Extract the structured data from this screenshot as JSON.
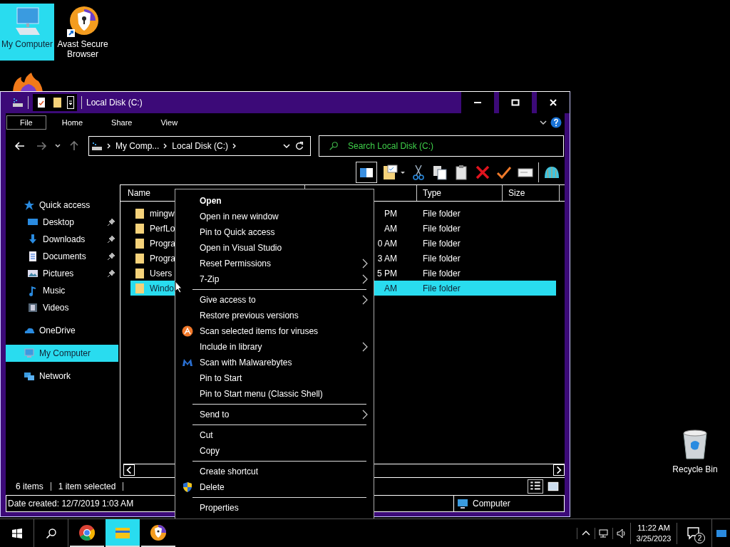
{
  "desktop_icons": [
    {
      "kind": "computer",
      "label": "My Computer",
      "selected": true
    },
    {
      "kind": "avast",
      "label": "Avast Secure Browser",
      "selected": false
    }
  ],
  "recycle_bin": {
    "label": "Recycle Bin"
  },
  "window": {
    "title": "Local Disk (C:)"
  },
  "ribbon_tabs": [
    {
      "label": "File",
      "selected": true
    },
    {
      "label": "Home",
      "selected": false
    },
    {
      "label": "Share",
      "selected": false
    },
    {
      "label": "View",
      "selected": false
    }
  ],
  "address": {
    "crumbs": [
      "My Comp...",
      "Local Disk (C:)"
    ]
  },
  "search": {
    "placeholder": "Search Local Disk (C:)"
  },
  "sidebar": {
    "items": [
      {
        "kind": "star",
        "label": "Quick access",
        "selected": false,
        "children": [
          {
            "kind": "desktop",
            "label": "Desktop",
            "pinned": true,
            "selected": false
          },
          {
            "kind": "downloads",
            "label": "Downloads",
            "pinned": true,
            "selected": false
          },
          {
            "kind": "documents",
            "label": "Documents",
            "pinned": true,
            "selected": false
          },
          {
            "kind": "pictures",
            "label": "Pictures",
            "pinned": true,
            "selected": false
          },
          {
            "kind": "music",
            "label": "Music",
            "pinned": false,
            "selected": false
          },
          {
            "kind": "videos",
            "label": "Videos",
            "pinned": false,
            "selected": false
          }
        ]
      },
      {
        "kind": "cloud",
        "label": "OneDrive",
        "selected": false
      },
      {
        "kind": "computer",
        "label": "My Computer",
        "selected": true
      },
      {
        "kind": "network",
        "label": "Network",
        "selected": false
      }
    ]
  },
  "table": {
    "columns": [
      "Name",
      "Type",
      "Size"
    ],
    "rows": [
      {
        "name": "mingw",
        "column_2": "PM",
        "type": "File folder",
        "selected": false
      },
      {
        "name": "PerfLo",
        "column_2": "AM",
        "type": "File folder",
        "selected": false
      },
      {
        "name": "Progra",
        "column_2": "0 AM",
        "type": "File folder",
        "selected": false
      },
      {
        "name": "Progra",
        "column_2": "3 AM",
        "type": "File folder",
        "selected": false
      },
      {
        "name": "Users",
        "column_2": "5 PM",
        "type": "File folder",
        "selected": false
      },
      {
        "name": "Windo",
        "column_2": "AM",
        "type": "File folder",
        "selected": true
      }
    ]
  },
  "status_bar": {
    "count": "6 items",
    "selection": "1 item selected"
  },
  "details_bar": {
    "created": "Date created: 12/7/2019 1:03 AM",
    "location": "Computer"
  },
  "context_menu": [
    {
      "kind": "default",
      "label": "Open"
    },
    {
      "kind": "plain",
      "label": "Open in new window"
    },
    {
      "kind": "plain",
      "label": "Pin to Quick access"
    },
    {
      "kind": "plain",
      "label": "Open in Visual Studio"
    },
    {
      "kind": "submenu",
      "label": "Reset Permissions"
    },
    {
      "kind": "submenu",
      "label": "7-Zip"
    },
    {
      "kind": "separator"
    },
    {
      "kind": "submenu",
      "label": "Give access to"
    },
    {
      "kind": "plain",
      "label": "Restore previous versions"
    },
    {
      "kind": "plain",
      "label": "Scan selected items for viruses"
    },
    {
      "kind": "submenu",
      "label": "Include in library"
    },
    {
      "kind": "plain",
      "label": "Scan with Malwarebytes"
    },
    {
      "kind": "plain",
      "label": "Pin to Start"
    },
    {
      "kind": "plain",
      "label": "Pin to Start menu (Classic Shell)"
    },
    {
      "kind": "separator"
    },
    {
      "kind": "submenu",
      "label": "Send to"
    },
    {
      "kind": "separator"
    },
    {
      "kind": "plain",
      "label": "Cut"
    },
    {
      "kind": "plain",
      "label": "Copy"
    },
    {
      "kind": "separator"
    },
    {
      "kind": "plain",
      "label": "Create shortcut"
    },
    {
      "kind": "plain",
      "label": "Delete"
    },
    {
      "kind": "separator"
    },
    {
      "kind": "plain",
      "label": "Properties"
    }
  ],
  "taskbar": {
    "apps": [
      {
        "kind": "chrome",
        "selected": false
      },
      {
        "kind": "explorer",
        "selected": true
      },
      {
        "kind": "avast",
        "selected": false
      }
    ],
    "time": "11:22 AM",
    "date": "3/25/2023",
    "notifications": "2"
  }
}
